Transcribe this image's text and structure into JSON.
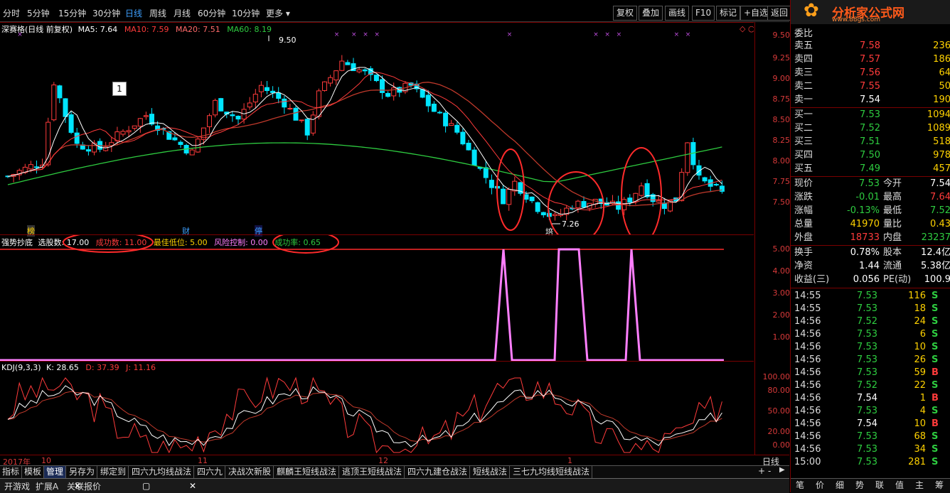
{
  "toolbar": {
    "periods": [
      "分时",
      "5分钟",
      "15分钟",
      "30分钟",
      "日线",
      "周线",
      "月线",
      "60分钟",
      "10分钟",
      "更多"
    ],
    "active_period": "日线",
    "buttons": [
      "复权",
      "叠加",
      "画线",
      "F10",
      "标记",
      "+自选",
      "返回"
    ]
  },
  "logo": {
    "title": "分析家公式网",
    "url": "www.88gs.com"
  },
  "main_header": {
    "name": "深赛格(日线 前复权)",
    "ma5": "MA5: 7.64",
    "ma10": "MA10: 7.59",
    "ma20": "MA20: 7.51",
    "ma60": "MA60: 8.19",
    "high_label": "9.50",
    "low_label": "7.26",
    "box_label": "1",
    "marker_labels": [
      "榜",
      "财",
      "停",
      "培"
    ],
    "y_ticks": [
      "9.50",
      "9.25",
      "9.00",
      "8.75",
      "8.50",
      "8.25",
      "8.00",
      "7.75",
      "7.50"
    ]
  },
  "indicator": {
    "name": "强势抄底",
    "params": [
      {
        "label": "选股数: 17.00",
        "color": "#ffffff"
      },
      {
        "label": "成功数: 11.00",
        "color": "#ff3b3b"
      },
      {
        "label": "最佳低位: 5.00",
        "color": "#ffd200"
      },
      {
        "label": "风险控制: 0.00",
        "color": "#ff7fff"
      },
      {
        "label": "成功率: 0.65",
        "color": "#2ecc40"
      }
    ],
    "y_ticks": [
      "5.00",
      "4.00",
      "3.00",
      "2.00",
      "1.00"
    ]
  },
  "kdj": {
    "name": "KDJ(9,3,3)",
    "k": "K: 28.65",
    "d": "D: 37.39",
    "j": "J: 11.16",
    "y_ticks": [
      "100.00",
      "80.00",
      "50.00",
      "20.00",
      "0.00"
    ]
  },
  "date_axis": {
    "labels": [
      "2017年",
      "10",
      "11",
      "12",
      "1"
    ],
    "period_label": "日线"
  },
  "bottom_tabs": [
    "指标",
    "模板",
    "管理",
    "另存为",
    "绑定到",
    "四六九均线战法",
    "四六九",
    "决战次新股",
    "麒麟王短线战法",
    "逃顶王短线战法",
    "四六九建仓战法",
    "短线战法",
    "三七九均线短线战法"
  ],
  "active_tab": "管理",
  "taskbar": {
    "items": [
      "开游戏",
      "扩展A",
      "关联报价"
    ]
  },
  "order_book": {
    "header": "委比",
    "asks": [
      {
        "label": "卖五",
        "price": "7.58",
        "vol": "236"
      },
      {
        "label": "卖四",
        "price": "7.57",
        "vol": "186"
      },
      {
        "label": "卖三",
        "price": "7.56",
        "vol": "64"
      },
      {
        "label": "卖二",
        "price": "7.55",
        "vol": "50"
      },
      {
        "label": "卖一",
        "price": "7.54",
        "vol": "190"
      }
    ],
    "bids": [
      {
        "label": "买一",
        "price": "7.53",
        "vol": "1094"
      },
      {
        "label": "买二",
        "price": "7.52",
        "vol": "1089"
      },
      {
        "label": "买三",
        "price": "7.51",
        "vol": "518"
      },
      {
        "label": "买四",
        "price": "7.50",
        "vol": "978"
      },
      {
        "label": "买五",
        "price": "7.49",
        "vol": "457"
      }
    ]
  },
  "quote": [
    {
      "l1": "现价",
      "v1": "7.53",
      "c1": "#2ecc40",
      "l2": "今开",
      "v2": "7.54",
      "c2": "#fff"
    },
    {
      "l1": "涨跌",
      "v1": "-0.01",
      "c1": "#2ecc40",
      "l2": "最高",
      "v2": "7.64",
      "c2": "#ff3b3b"
    },
    {
      "l1": "涨幅",
      "v1": "-0.13%",
      "c1": "#2ecc40",
      "l2": "最低",
      "v2": "7.52",
      "c2": "#2ecc40"
    },
    {
      "l1": "总量",
      "v1": "41970",
      "c1": "#ffd200",
      "l2": "量比",
      "v2": "0.43",
      "c2": "#ffd200"
    },
    {
      "l1": "外盘",
      "v1": "18733",
      "c1": "#ff3b3b",
      "l2": "内盘",
      "v2": "23237",
      "c2": "#2ecc40"
    }
  ],
  "finance": [
    {
      "l1": "换手",
      "v1": "0.78%",
      "l2": "股本",
      "v2": "12.4亿"
    },
    {
      "l1": "净资",
      "v1": "1.44",
      "l2": "流通",
      "v2": "5.38亿"
    },
    {
      "l1": "收益(三)",
      "v1": "0.056",
      "l2": "PE(动)",
      "v2": "100.9"
    }
  ],
  "ticks": [
    {
      "t": "14:55",
      "p": "7.53",
      "pc": "#2ecc40",
      "v": "116",
      "d": "S",
      "dc": "#2ecc40"
    },
    {
      "t": "14:55",
      "p": "7.53",
      "pc": "#2ecc40",
      "v": "18",
      "d": "S",
      "dc": "#2ecc40"
    },
    {
      "t": "14:56",
      "p": "7.52",
      "pc": "#2ecc40",
      "v": "24",
      "d": "S",
      "dc": "#2ecc40"
    },
    {
      "t": "14:56",
      "p": "7.53",
      "pc": "#2ecc40",
      "v": "6",
      "d": "S",
      "dc": "#2ecc40"
    },
    {
      "t": "14:56",
      "p": "7.53",
      "pc": "#2ecc40",
      "v": "10",
      "d": "S",
      "dc": "#2ecc40"
    },
    {
      "t": "14:56",
      "p": "7.53",
      "pc": "#2ecc40",
      "v": "26",
      "d": "S",
      "dc": "#2ecc40"
    },
    {
      "t": "14:56",
      "p": "7.53",
      "pc": "#2ecc40",
      "v": "59",
      "d": "B",
      "dc": "#ff3b3b"
    },
    {
      "t": "14:56",
      "p": "7.52",
      "pc": "#2ecc40",
      "v": "22",
      "d": "S",
      "dc": "#2ecc40"
    },
    {
      "t": "14:56",
      "p": "7.54",
      "pc": "#fff",
      "v": "1",
      "d": "B",
      "dc": "#ff3b3b"
    },
    {
      "t": "14:56",
      "p": "7.53",
      "pc": "#2ecc40",
      "v": "4",
      "d": "S",
      "dc": "#2ecc40"
    },
    {
      "t": "14:56",
      "p": "7.54",
      "pc": "#fff",
      "v": "10",
      "d": "B",
      "dc": "#ff3b3b"
    },
    {
      "t": "14:56",
      "p": "7.53",
      "pc": "#2ecc40",
      "v": "68",
      "d": "S",
      "dc": "#2ecc40"
    },
    {
      "t": "14:56",
      "p": "7.53",
      "pc": "#2ecc40",
      "v": "34",
      "d": "S",
      "dc": "#2ecc40"
    },
    {
      "t": "15:00",
      "p": "7.53",
      "pc": "#2ecc40",
      "v": "281",
      "d": "S",
      "dc": "#2ecc40"
    }
  ],
  "right_tabs": [
    "笔",
    "价",
    "细",
    "势",
    "联",
    "值",
    "主",
    "筹"
  ],
  "colors": {
    "up": "#ff3b3b",
    "down": "#00e5ff",
    "ma5": "#ffffff",
    "ma10": "#ff3b3b",
    "ma20": "#c0392b",
    "ma60": "#2ecc40",
    "signal": "#ff7fff",
    "ellipse": "#ff2b2b"
  },
  "chart_data": {
    "type": "line",
    "price_range": [
      7.26,
      9.5
    ],
    "ma_values": {
      "MA5": 7.64,
      "MA10": 7.59,
      "MA20": 7.51,
      "MA60": 8.19
    },
    "signal_ylim": [
      0,
      5
    ],
    "kdj_ylim": [
      0,
      100
    ],
    "kdj_values": {
      "K": 28.65,
      "D": 37.39,
      "J": 11.16
    }
  }
}
